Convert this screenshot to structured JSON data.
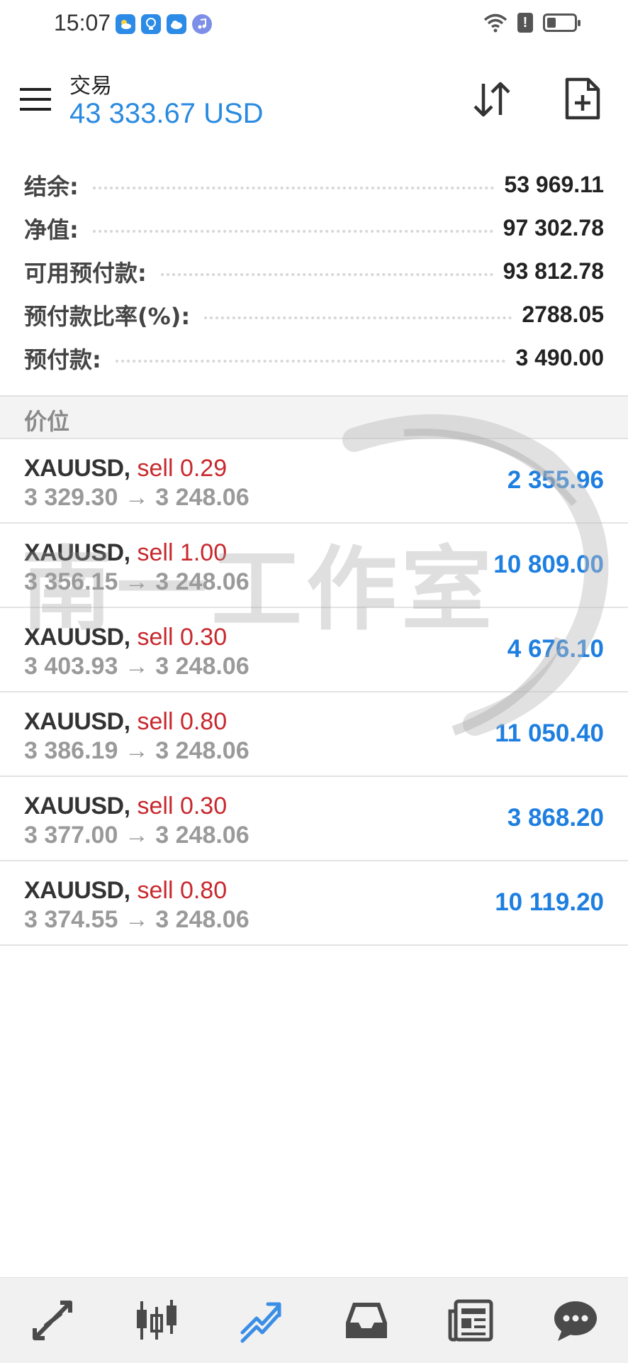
{
  "status_bar": {
    "time": "15:07",
    "alert_glyph": "!"
  },
  "header": {
    "title": "交易",
    "balance": "43 333.67 USD"
  },
  "summary": [
    {
      "label": "结余:",
      "value": "53 969.11"
    },
    {
      "label": "净值:",
      "value": "97 302.78"
    },
    {
      "label": "可用预付款:",
      "value": "93 812.78"
    },
    {
      "label": "预付款比率(%):",
      "value": "2788.05"
    },
    {
      "label": "预付款:",
      "value": "3 490.00"
    }
  ],
  "positions_section": {
    "title": "价位"
  },
  "positions": [
    {
      "symbol": "XAUUSD",
      "side": "sell 0.29",
      "open_price": "3 329.30",
      "arrow": "→",
      "current_price": "3 248.06",
      "profit": "2 355.96"
    },
    {
      "symbol": "XAUUSD",
      "side": "sell 1.00",
      "open_price": "3 356.15",
      "arrow": "→",
      "current_price": "3 248.06",
      "profit": "10 809.00"
    },
    {
      "symbol": "XAUUSD",
      "side": "sell 0.30",
      "open_price": "3 403.93",
      "arrow": "→",
      "current_price": "3 248.06",
      "profit": "4 676.10"
    },
    {
      "symbol": "XAUUSD",
      "side": "sell 0.80",
      "open_price": "3 386.19",
      "arrow": "→",
      "current_price": "3 248.06",
      "profit": "11 050.40"
    },
    {
      "symbol": "XAUUSD",
      "side": "sell 0.30",
      "open_price": "3 377.00",
      "arrow": "→",
      "current_price": "3 248.06",
      "profit": "3 868.20"
    },
    {
      "symbol": "XAUUSD",
      "side": "sell 0.80",
      "open_price": "3 374.55",
      "arrow": "→",
      "current_price": "3 248.06",
      "profit": "10 119.20"
    }
  ],
  "watermark": {
    "text": "南一工作室"
  },
  "bottom_nav": [
    {
      "icon": "quotes-arrows-icon",
      "active": false
    },
    {
      "icon": "chart-candles-icon",
      "active": false
    },
    {
      "icon": "trade-trend-icon",
      "active": true
    },
    {
      "icon": "history-inbox-icon",
      "active": false
    },
    {
      "icon": "news-icon",
      "active": false
    },
    {
      "icon": "chat-icon",
      "active": false
    }
  ],
  "colors": {
    "accent_blue": "#2a8ae0",
    "profit_blue": "#1e7fe0",
    "sell_red": "#c8282d",
    "muted_gray": "#9a9a9a",
    "nav_active": "#3a8ee6",
    "nav_inactive": "#4a4a4a"
  }
}
